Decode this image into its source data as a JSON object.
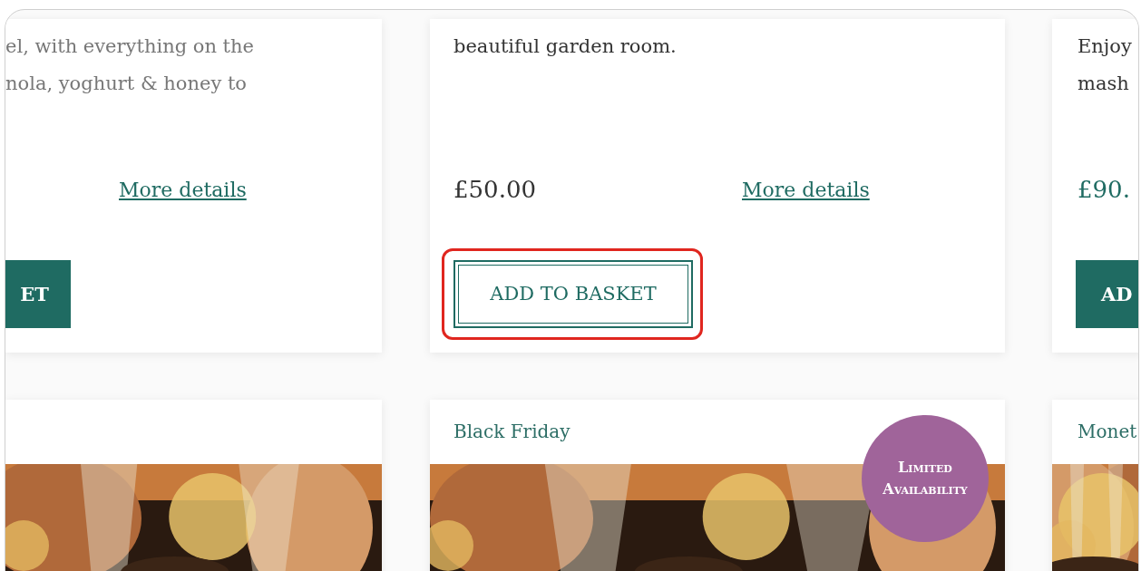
{
  "top_cards": [
    {
      "description": "el, with everything on the\nnola, yoghurt & honey to",
      "faded": true,
      "link": "More details",
      "button": {
        "label": "ET",
        "kind": "filled",
        "highlighted": false
      }
    },
    {
      "description": "beautiful garden room.",
      "price": "£50.00",
      "link": "More details",
      "button": {
        "label": "ADD TO BASKET",
        "kind": "outlined",
        "highlighted": true
      }
    },
    {
      "description": "Enjoy\nmash",
      "price": "£90.",
      "button": {
        "label": "AD",
        "kind": "filled",
        "highlighted": false
      }
    }
  ],
  "bottom_cards": [
    {
      "picture": {
        "kind": "picture"
      }
    },
    {
      "category": "Black Friday",
      "badge": "Limited Availability",
      "picture": {
        "kind": "picture"
      }
    },
    {
      "category": "Monet",
      "picture": {
        "kind": "picture"
      }
    }
  ]
}
